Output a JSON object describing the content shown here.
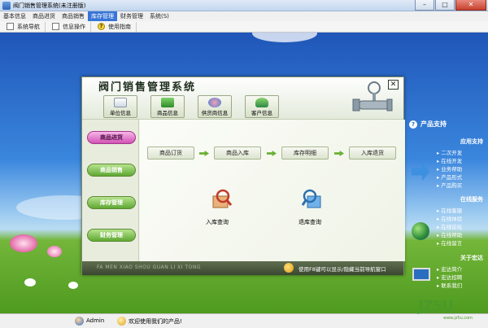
{
  "window": {
    "title": "阀门销售管理系统(未注册版)"
  },
  "menubar": {
    "items": [
      "基本信息",
      "商品进货",
      "商品销售",
      "库存管理",
      "财务管理",
      "系统(S)"
    ],
    "active": "库存管理"
  },
  "toolbar": {
    "items": [
      "系统导航",
      "信息操作",
      "使用指南"
    ]
  },
  "dialog": {
    "title": "阀门销售管理系统",
    "close": "✕",
    "top_buttons": [
      "单位信息",
      "商品信息",
      "供货商信息",
      "客户信息"
    ],
    "nav": [
      "商品进货",
      "商品销售",
      "库存管理",
      "财务管理"
    ],
    "nav_active": "商品进货",
    "flow": [
      "商品订货",
      "商品入库",
      "库存明细",
      "入库退货"
    ],
    "queries": [
      "入库查询",
      "退库查询"
    ],
    "footer_pinyin": "FA MEN XIAO SHOU GUAN LI XI TONG",
    "footer_hint": "使用F8键可以显示/隐藏当前导航窗口"
  },
  "support": {
    "title": "产品支持",
    "sections": [
      {
        "heading": "应用支持",
        "links": [
          "二次开发",
          "在线开发",
          "业务帮助",
          "产品形式",
          "产品购买"
        ]
      },
      {
        "heading": "在线服务",
        "links": [
          "在线客服",
          "在线体验",
          "在线论坛",
          "在线帮助",
          "在线留言"
        ]
      },
      {
        "heading": "关于宏达",
        "links": [
          "宏达简介",
          "宏达招聘",
          "联系我们"
        ]
      }
    ]
  },
  "statusbar": {
    "user": "Admin",
    "welcome": "欢迎使用我们的产品!"
  },
  "watermark": {
    "logo": "JZ5U",
    "url": "www.jz5u.com"
  },
  "colors": {
    "nav_green": "#5fa833",
    "nav_active": "#d252b5",
    "menu_active": "#3875d7",
    "flow_arrow": "#69b233"
  }
}
